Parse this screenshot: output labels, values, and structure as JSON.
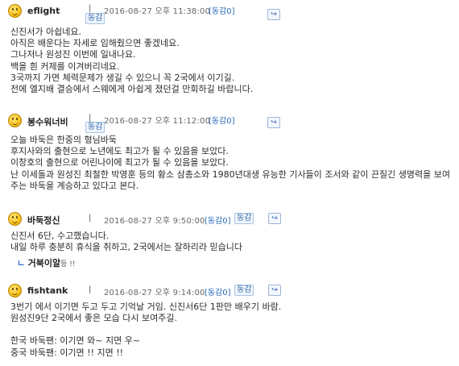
{
  "comments": [
    {
      "nickname": "eflight",
      "separator": "|",
      "date": "2016-08-27 오후 11:38:00",
      "agree_label": "[동감0]",
      "badge": "동감",
      "reply_icon": "↪",
      "lines": [
        "신진서가 아쉽네요.",
        "아직은 배운다는 자세로 임해줬으면 좋겠네요.",
        "그나저나 원성진 이번에 일내나요.",
        "백을 흰 커제를 이겨버리네요.",
        "3국까지 가면 체력문제가 생길 수 있으니 꼭 2국에서 이기길.",
        "전에 엘지배 결승에서 스웨에게 아쉽게 졌던걸 만회하길 바랍니다."
      ]
    },
    {
      "nickname": "봉수워너비",
      "separator": "|",
      "date": "2016-08-27 오후 11:12:00",
      "agree_label": "[동감0]",
      "badge": "동감",
      "reply_icon": "↪",
      "lines": [
        "오늘 바둑은 한중의 형님바둑",
        "후지사와의 출현으로 노년에도 최고가 될 수 있음을 보았다.",
        "이창호의 출현으로 어린나이에 최고가 될 수 있음을 보았다.",
        "난 이세돌과 원성진 최철한 박영훈 등의 황소 삼총소와 1980년대생 유능한 기사들이 조서와 같이 끈질긴 생명력을 보여주는 바둑을 계승하고 있다고 본다."
      ]
    },
    {
      "nickname": "바둑정신",
      "separator": "|",
      "date": "2016-08-27 오후 9:50:00",
      "agree_label": "[동감0]",
      "badge": "동감",
      "reply_icon": "↪",
      "lines": [
        "신진서 6단, 수고했습니다.",
        "내일 하루 충분히 휴식을 취하고, 2국에서는 잘하리라 믿습니다"
      ],
      "sub_reply": {
        "arrow": "ㄴ",
        "user": "거북이알",
        "suffix": "등 !!"
      }
    },
    {
      "nickname": "fishtank",
      "separator": "|",
      "date": "2016-08-27 오후 9:14:00",
      "agree_label": "[동감0]",
      "badge": "동감",
      "reply_icon": "↪",
      "lines": [
        "3번기 에서 이기면 두고 두고 기억날 거임. 신진서6단 1판만 배우기 바람.",
        "원성진9단 2국에서 좋은 모습 다시 보여주길.",
        "",
        "한국 바둑팬: 이기면 와~ 지면 우~",
        "중국 바둑팬: 이기면 !! 지면 !!"
      ]
    }
  ]
}
